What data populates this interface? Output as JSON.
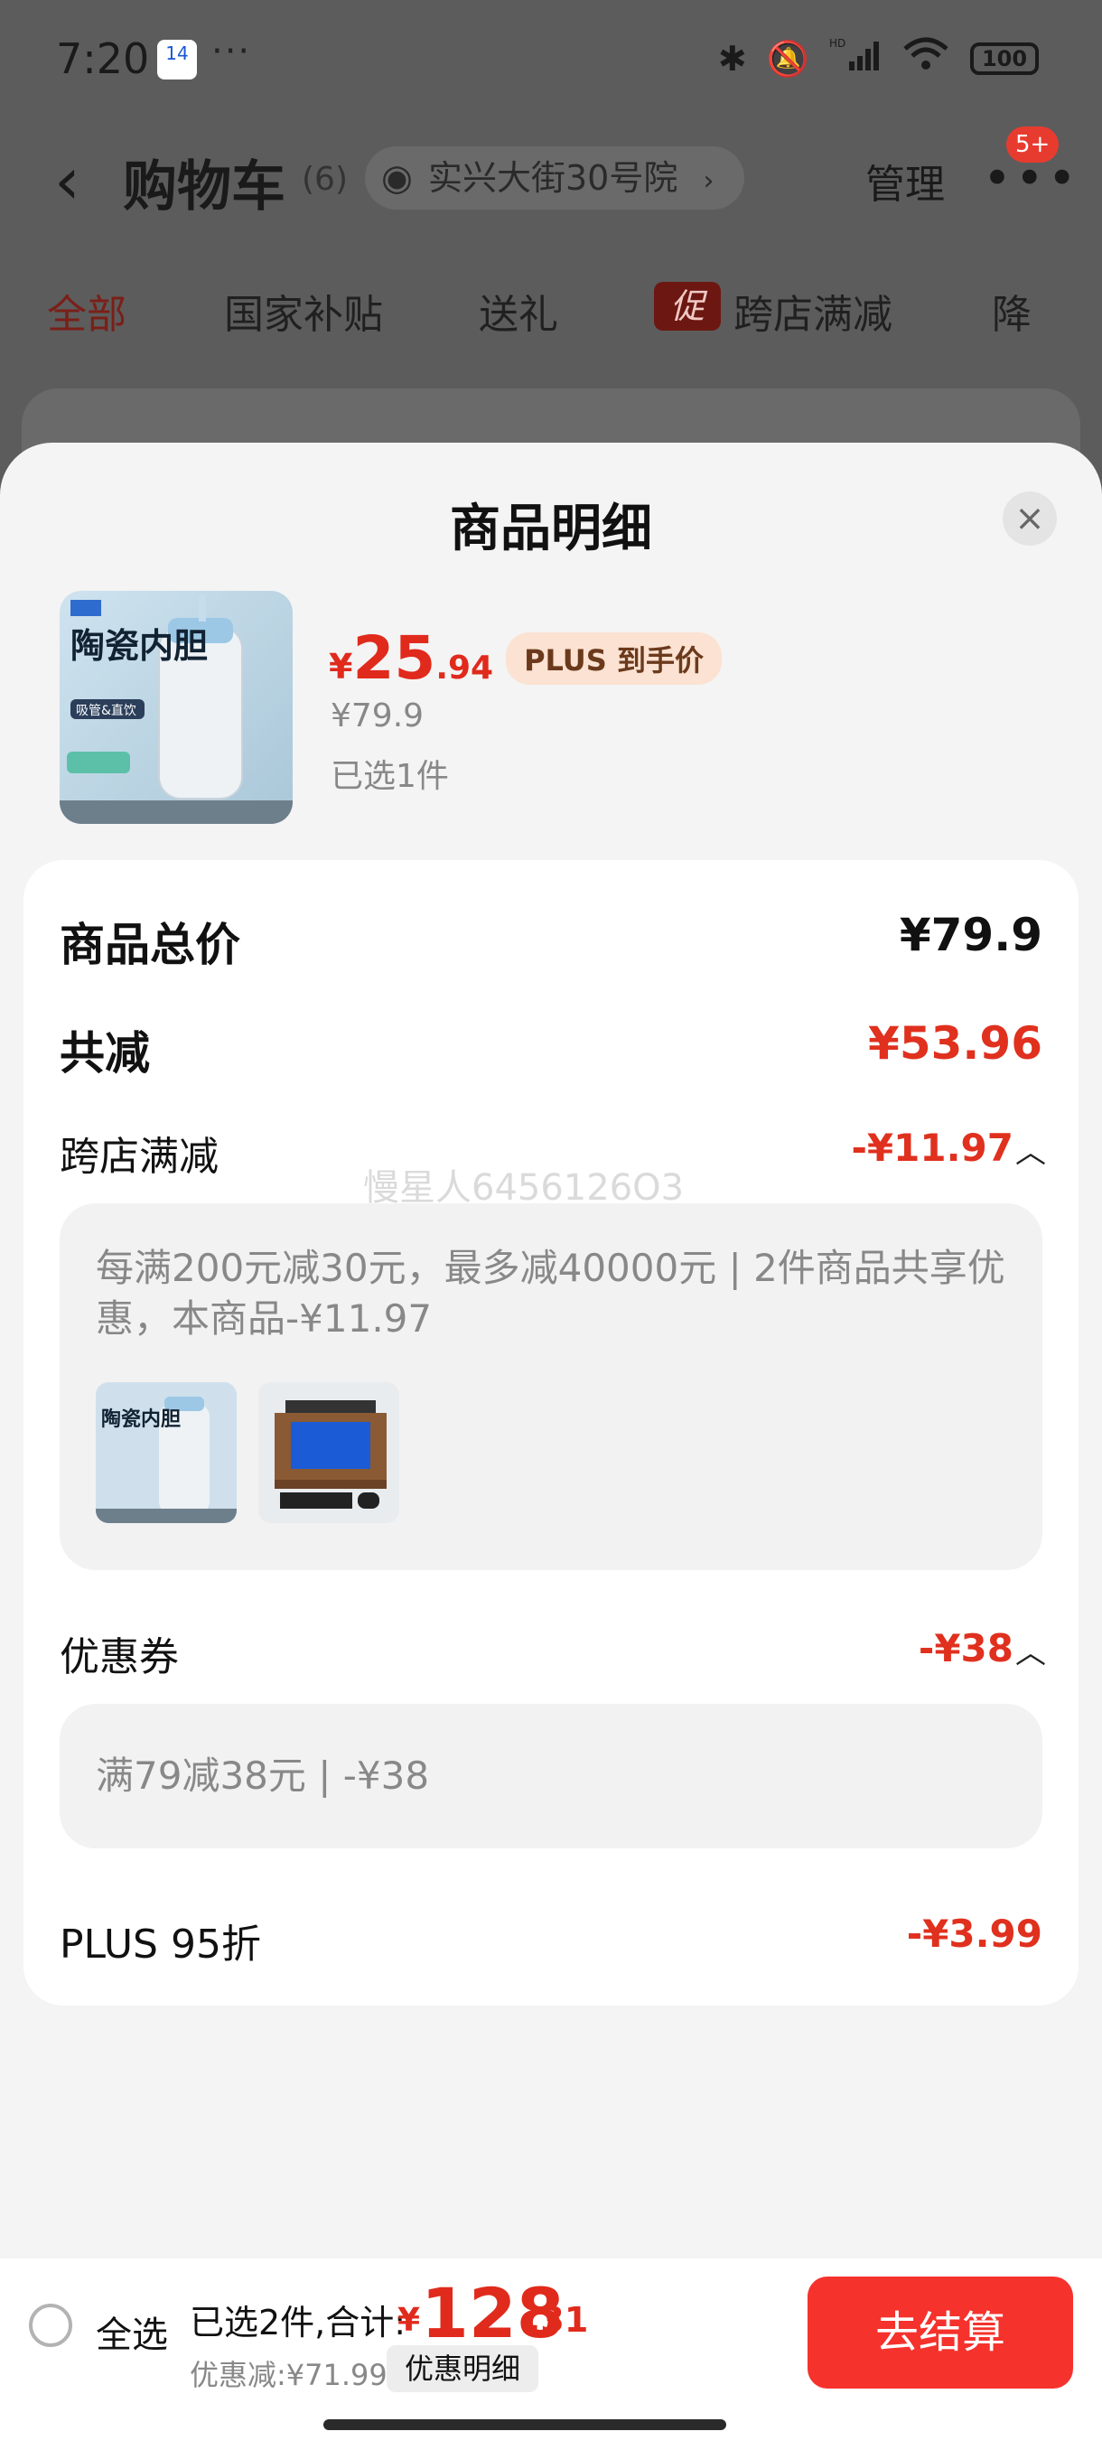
{
  "status": {
    "time": "7:20",
    "calendar_day": "14",
    "overflow": "···",
    "battery": "100",
    "network": "HD"
  },
  "header": {
    "title": "购物车",
    "count": "(6)",
    "address": "实兴大街30号院",
    "manage": "管理",
    "badge": "5+"
  },
  "tabs": [
    {
      "label": "全部"
    },
    {
      "label": "国家补贴"
    },
    {
      "label": "送礼"
    },
    {
      "label": "跨店满减",
      "tag": "促"
    },
    {
      "label": "降"
    }
  ],
  "sheet": {
    "title": "商品明细",
    "product": {
      "img_text": "陶瓷内胆",
      "img_sub": "吸管&直饮",
      "price_symbol": "¥",
      "price_int": "25",
      "price_dec": ".94",
      "plus_tag": "PLUS 到手价",
      "original_price": "¥79.9",
      "selected": "已选1件"
    },
    "details": {
      "total_label": "商品总价",
      "total_value": "¥79.9",
      "reduce_label": "共减",
      "reduce_value": "¥53.96",
      "cross_label": "跨店满减",
      "cross_value": "-¥11.97",
      "cross_desc": "每满200元减30元，最多减40000元 | 2件商品共享优惠，本商品-¥11.97",
      "coupon_label": "优惠券",
      "coupon_value": "-¥38",
      "coupon_desc": "满79减38元 | -¥38",
      "plus_label": "PLUS 95折",
      "plus_value": "-¥3.99",
      "watermark": "慢星人6456126O3"
    }
  },
  "bottom": {
    "select_all": "全选",
    "summary": "已选2件,合计:",
    "total_symbol": "¥",
    "total_int": "128",
    "total_dec": ".31",
    "saved": "优惠减:¥71.99",
    "detail_button": "优惠明细",
    "checkout": "去结算"
  },
  "colors": {
    "accent_red": "#e0301e",
    "checkout_red": "#f5322c",
    "sheet_bg": "#f4f4f4"
  }
}
